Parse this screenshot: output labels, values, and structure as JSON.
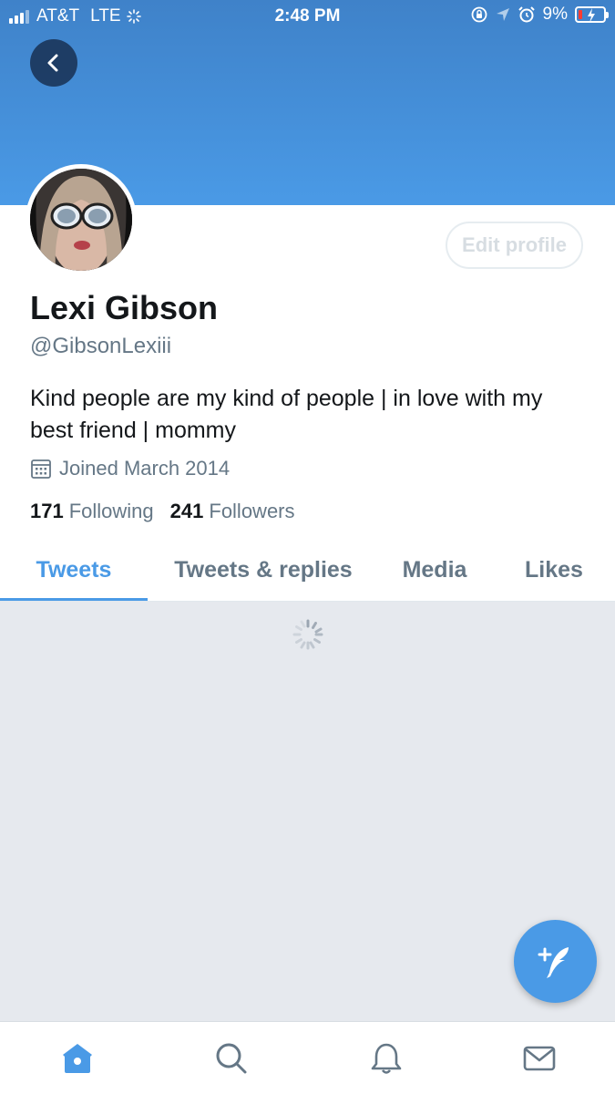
{
  "status_bar": {
    "carrier": "AT&T",
    "network": "LTE",
    "time": "2:48 PM",
    "battery_percent": "9%",
    "battery_level": 0.09
  },
  "profile": {
    "display_name": "Lexi Gibson",
    "handle": "@GibsonLexiii",
    "bio": "Kind people are my kind of people | in love with my best friend | mommy",
    "joined": "Joined March 2014",
    "edit_profile_label": "Edit profile"
  },
  "stats": {
    "following_count": "171",
    "following_label": "Following",
    "followers_count": "241",
    "followers_label": "Followers"
  },
  "tabs": [
    {
      "label": "Tweets",
      "active": true
    },
    {
      "label": "Tweets & replies",
      "active": false
    },
    {
      "label": "Media",
      "active": false
    },
    {
      "label": "Likes",
      "active": false
    }
  ],
  "icons": {
    "back": "chevron-left-icon",
    "calendar": "calendar-icon",
    "compose": "compose-feather-icon",
    "nav": [
      "home-icon",
      "search-icon",
      "notifications-bell-icon",
      "messages-mail-icon"
    ]
  },
  "colors": {
    "accent": "#4a9ae6",
    "banner": "#3f82c9",
    "feed_background": "#e6e9ee",
    "secondary_text": "#657786"
  }
}
